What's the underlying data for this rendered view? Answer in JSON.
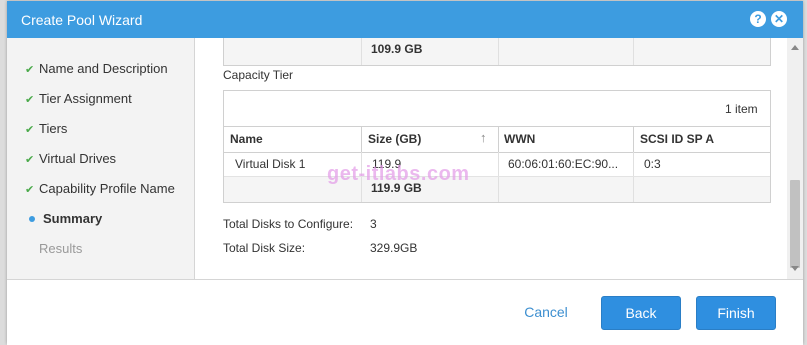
{
  "dialog": {
    "title": "Create Pool Wizard",
    "help_icon": "?",
    "close_icon": "✕"
  },
  "steps": [
    {
      "label": "Name and Description",
      "state": "done"
    },
    {
      "label": "Tier Assignment",
      "state": "done"
    },
    {
      "label": "Tiers",
      "state": "done"
    },
    {
      "label": "Virtual Drives",
      "state": "done"
    },
    {
      "label": "Capability Profile Name",
      "state": "done"
    },
    {
      "label": "Summary",
      "state": "current"
    },
    {
      "label": "Results",
      "state": "future"
    }
  ],
  "prev_table": {
    "total_size": "109.9 GB"
  },
  "capacity_tier": {
    "heading": "Capacity Tier",
    "item_count": "1 item",
    "columns": [
      "Name",
      "Size (GB)",
      "WWN",
      "SCSI ID SP A"
    ],
    "rows": [
      [
        "Virtual Disk 1",
        "119.9",
        "60:06:01:60:EC:90...",
        "0:3"
      ]
    ],
    "total_size": "119.9 GB"
  },
  "summary": {
    "disks_label": "Total Disks to Configure:",
    "disks_value": "3",
    "size_label": "Total Disk Size:",
    "size_value": "329.9GB"
  },
  "footer": {
    "cancel": "Cancel",
    "back": "Back",
    "finish": "Finish"
  },
  "watermark": "get-itlabs.com",
  "colors": {
    "accent": "#3d9ce0",
    "check": "#4aa94a"
  }
}
